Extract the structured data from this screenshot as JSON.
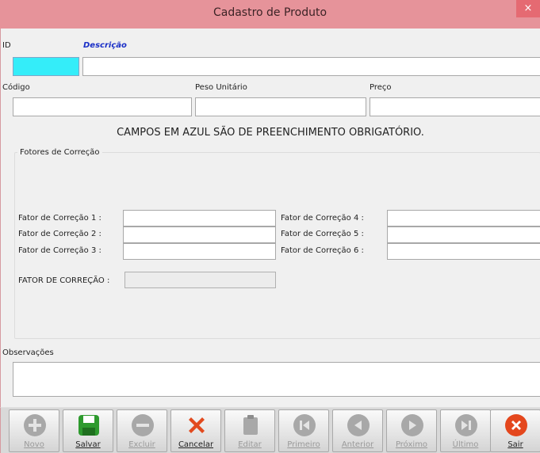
{
  "window": {
    "title": "Cadastro de Produto",
    "close_glyph": "×"
  },
  "fields": {
    "id_label": "ID",
    "descricao_label": "Descrição",
    "codigo_label": "Código",
    "peso_label": "Peso Unitário",
    "preco_label": "Preço"
  },
  "notice": "CAMPOS EM AZUL SÃO DE PREENCHIMENTO OBRIGATÓRIO.",
  "correction_group": {
    "title": "Fotores de Correção",
    "fator1": "Fator de Correção 1 :",
    "fator2": "Fator de Correção 2 :",
    "fator3": "Fator de Correção 3 :",
    "fator4": "Fator de Correção 4 :",
    "fator5": "Fator de Correção 5 :",
    "fator6": "Fator de Correção 6 :",
    "total_label": "FATOR  DE CORREÇÃO :"
  },
  "observacoes_label": "Observações",
  "colors": {
    "required_field": "#34edf9",
    "required_label": "#1a2fc7",
    "titlebar": "#e6939a",
    "close_button": "#e56a72"
  },
  "toolbar": {
    "novo": "Novo",
    "salvar": "Salvar",
    "excluir": "Excluir",
    "cancelar": "Cancelar",
    "editar": "Editar",
    "primeiro": "Primeiro",
    "anterior": "Anterior",
    "proximo": "Próximo",
    "ultimo": "Último",
    "sair": "Sair"
  },
  "icons": {
    "novo": "plus-circle-icon",
    "salvar": "floppy-disk-icon",
    "excluir": "minus-circle-icon",
    "cancelar": "red-x-icon",
    "editar": "clipboard-icon",
    "primeiro": "skip-first-icon",
    "anterior": "previous-icon",
    "proximo": "next-icon",
    "ultimo": "skip-last-icon",
    "sair": "exit-icon"
  }
}
